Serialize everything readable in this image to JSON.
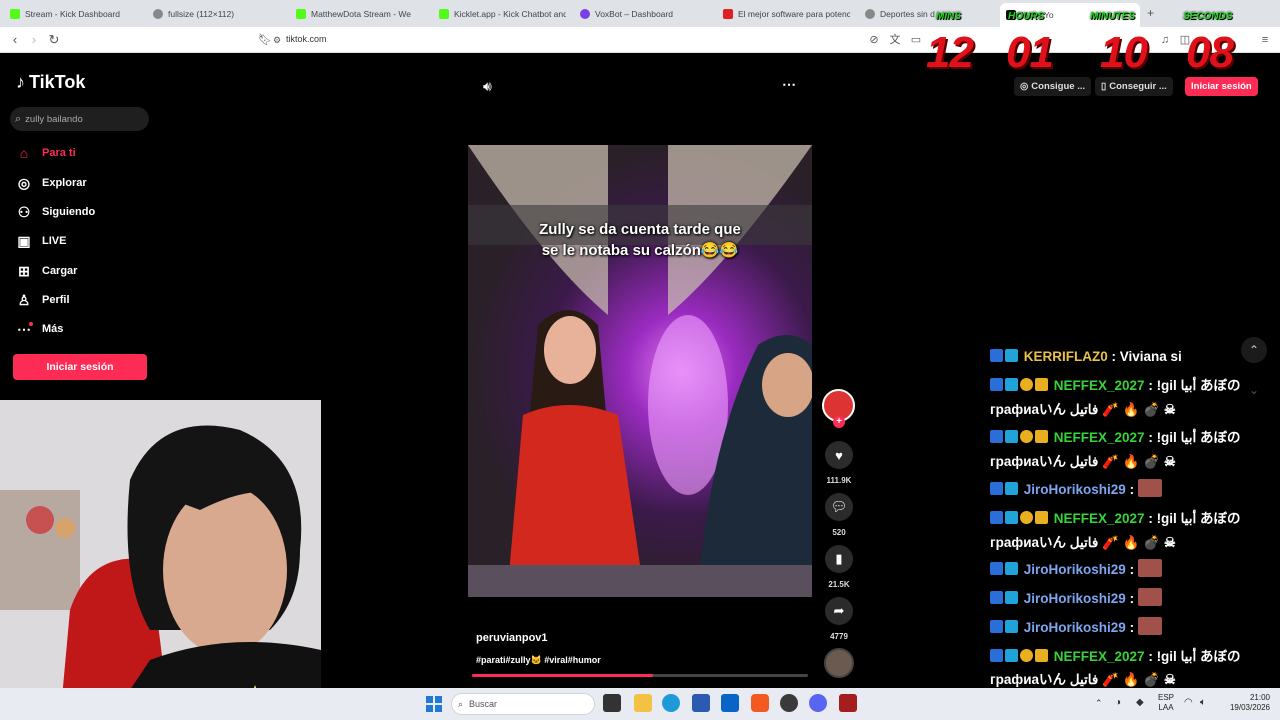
{
  "browser": {
    "tabs": [
      {
        "label": "Stream - Kick Dashboard",
        "color": "#53fc18"
      },
      {
        "label": "fullsize (112×112)",
        "color": "#888888"
      },
      {
        "label": "MatthewDota Stream - We",
        "color": "#53fc18"
      },
      {
        "label": "Kicklet.app - Kick Chatbot and",
        "color": "#53fc18"
      },
      {
        "label": "VoxBot – Dashboard",
        "color": "#7b3fe4"
      },
      {
        "label": "El mejor software para potencia",
        "color": "#e02020"
      },
      {
        "label": "Deportes sin dif",
        "color": "#888888"
      },
      {
        "label": "Make Yo",
        "color": "#111111"
      }
    ],
    "url": "tiktok.com"
  },
  "timer": {
    "labels": [
      "MINS",
      "HOURS",
      "MINUTES",
      "SECONDS"
    ],
    "values": [
      "12",
      "01",
      "10",
      "08"
    ]
  },
  "tiktok": {
    "logo": "TikTok",
    "search_placeholder": "zully bailando",
    "nav": [
      {
        "label": "Para ti",
        "icon": "home-icon",
        "active": true
      },
      {
        "label": "Explorar",
        "icon": "compass-icon"
      },
      {
        "label": "Siguiendo",
        "icon": "following-icon"
      },
      {
        "label": "LIVE",
        "icon": "live-icon"
      },
      {
        "label": "Cargar",
        "icon": "upload-icon"
      },
      {
        "label": "Perfil",
        "icon": "profile-icon"
      },
      {
        "label": "Más",
        "icon": "more-dots-icon"
      }
    ],
    "login_sidebar": "Iniciar sesión",
    "top_buttons": {
      "get_coins": "Consigue ...",
      "get_app": "Conseguir ...",
      "login": "Iniciar sesión"
    },
    "video": {
      "caption_line1": "Zully se da cuenta tarde que",
      "caption_line2": "se le notaba su calzón😂😂",
      "author": "peruvianpov1",
      "hashtags": "#parati#zully🐱 #viral#humor",
      "progress": 0.54
    },
    "actions": {
      "likes": "111.9K",
      "comments": "520",
      "saves": "21.5K",
      "shares": "4779"
    }
  },
  "chat": [
    {
      "user": "KERRIFLAZ0",
      "color": "gold",
      "msg": "Viviana si"
    },
    {
      "user": "NEFFEX_2027",
      "color": "green",
      "msg": "!gil أبيا あぼの",
      "msg2": "графиаいん فاتيل 🧨 🔥 💣 ☠"
    },
    {
      "user": "NEFFEX_2027",
      "color": "green",
      "msg": "!gil أبيا あぼの",
      "msg2": "графиаいん فاتيل 🧨 🔥 💣 ☠"
    },
    {
      "user": "JiroHorikoshi29",
      "color": "blue",
      "msg": ""
    },
    {
      "user": "NEFFEX_2027",
      "color": "green",
      "msg": "!gil أبيا あぼの",
      "msg2": "графиаいん فاتيل 🧨 🔥 💣 ☠"
    },
    {
      "user": "JiroHorikoshi29",
      "color": "blue",
      "msg": ""
    },
    {
      "user": "JiroHorikoshi29",
      "color": "blue",
      "msg": ""
    },
    {
      "user": "JiroHorikoshi29",
      "color": "blue",
      "msg": ""
    },
    {
      "user": "NEFFEX_2027",
      "color": "green",
      "msg": "!gil أبيا あぼの",
      "msg2": "графиаいん فاتيل 🧨 🔥 💣 ☠"
    }
  ],
  "taskbar": {
    "search_placeholder": "Buscar",
    "lang": "ESP",
    "lang2": "LAA",
    "time": "21:00",
    "date": "19/03/2026"
  }
}
